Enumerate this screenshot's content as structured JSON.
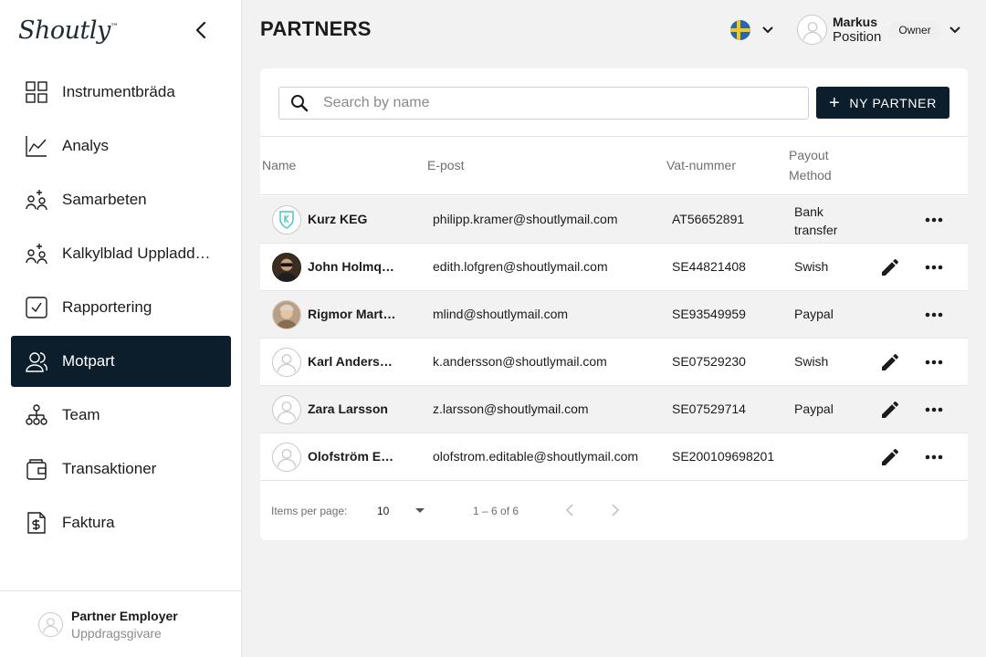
{
  "app": {
    "logo": "Shoutly",
    "logo_mark": "™"
  },
  "sidebar": {
    "items": [
      {
        "label": "Instrumentbräda",
        "icon": "grid-icon",
        "active": false
      },
      {
        "label": "Analys",
        "icon": "chart-line-icon",
        "active": false
      },
      {
        "label": "Samarbeten",
        "icon": "users-add-icon",
        "active": false
      },
      {
        "label": "Kalkylblad Uppladdning",
        "icon": "users-add-icon",
        "active": false
      },
      {
        "label": "Rapportering",
        "icon": "checkbox-icon",
        "active": false
      },
      {
        "label": "Motpart",
        "icon": "contacts-icon",
        "active": true
      },
      {
        "label": "Team",
        "icon": "team-icon",
        "active": false
      },
      {
        "label": "Transaktioner",
        "icon": "wallet-icon",
        "active": false
      },
      {
        "label": "Faktura",
        "icon": "invoice-icon",
        "active": false
      }
    ],
    "footer": {
      "name": "Partner Employer",
      "role": "Uppdragsgivare"
    }
  },
  "header": {
    "title": "PARTNERS",
    "user": {
      "name": "Markus",
      "position": "Position",
      "badge": "Owner"
    },
    "language_flag": "sweden-flag-icon"
  },
  "toolbar": {
    "search_placeholder": "Search by name",
    "search_value": "",
    "new_partner_label": "NY PARTNER"
  },
  "table": {
    "columns": {
      "name": "Name",
      "email": "E-post",
      "vat": "Vat-nummer",
      "payout_line1": "Payout",
      "payout_line2": "Method"
    },
    "rows": [
      {
        "name": "Kurz KEG",
        "email": "philipp.kramer@shoutlymail.com",
        "vat": "AT56652891",
        "payout_line1": "Bank",
        "payout_line2": "transfer",
        "editable": false,
        "avatar": "logo"
      },
      {
        "name": "John Holmqvist",
        "email": "edith.lofgren@shoutlymail.com",
        "vat": "SE44821408",
        "payout_line1": "Swish",
        "payout_line2": "",
        "editable": true,
        "avatar": "photo-dark"
      },
      {
        "name": "Rigmor Martinsson",
        "email": "mlind@shoutlymail.com",
        "vat": "SE93549959",
        "payout_line1": "Paypal",
        "payout_line2": "",
        "editable": false,
        "avatar": "photo-light"
      },
      {
        "name": "Karl Andersson",
        "email": "k.andersson@shoutlymail.com",
        "vat": "SE07529230",
        "payout_line1": "Swish",
        "payout_line2": "",
        "editable": true,
        "avatar": "placeholder"
      },
      {
        "name": "Zara Larsson",
        "email": "z.larsson@shoutlymail.com",
        "vat": "SE07529714",
        "payout_line1": "Paypal",
        "payout_line2": "",
        "editable": true,
        "avatar": "placeholder"
      },
      {
        "name": "Olofström Editable",
        "email": "olofstrom.editable@shoutlymail.com",
        "vat": "SE200109698201",
        "payout_line1": "",
        "payout_line2": "",
        "editable": true,
        "avatar": "placeholder"
      }
    ]
  },
  "pagination": {
    "items_per_page_label": "Items per page:",
    "page_size": "10",
    "range": "1 – 6 of 6"
  },
  "colors": {
    "primary": "#0c1e2c",
    "row_alt": "#f2f2f2",
    "background": "#f2f2f2"
  }
}
